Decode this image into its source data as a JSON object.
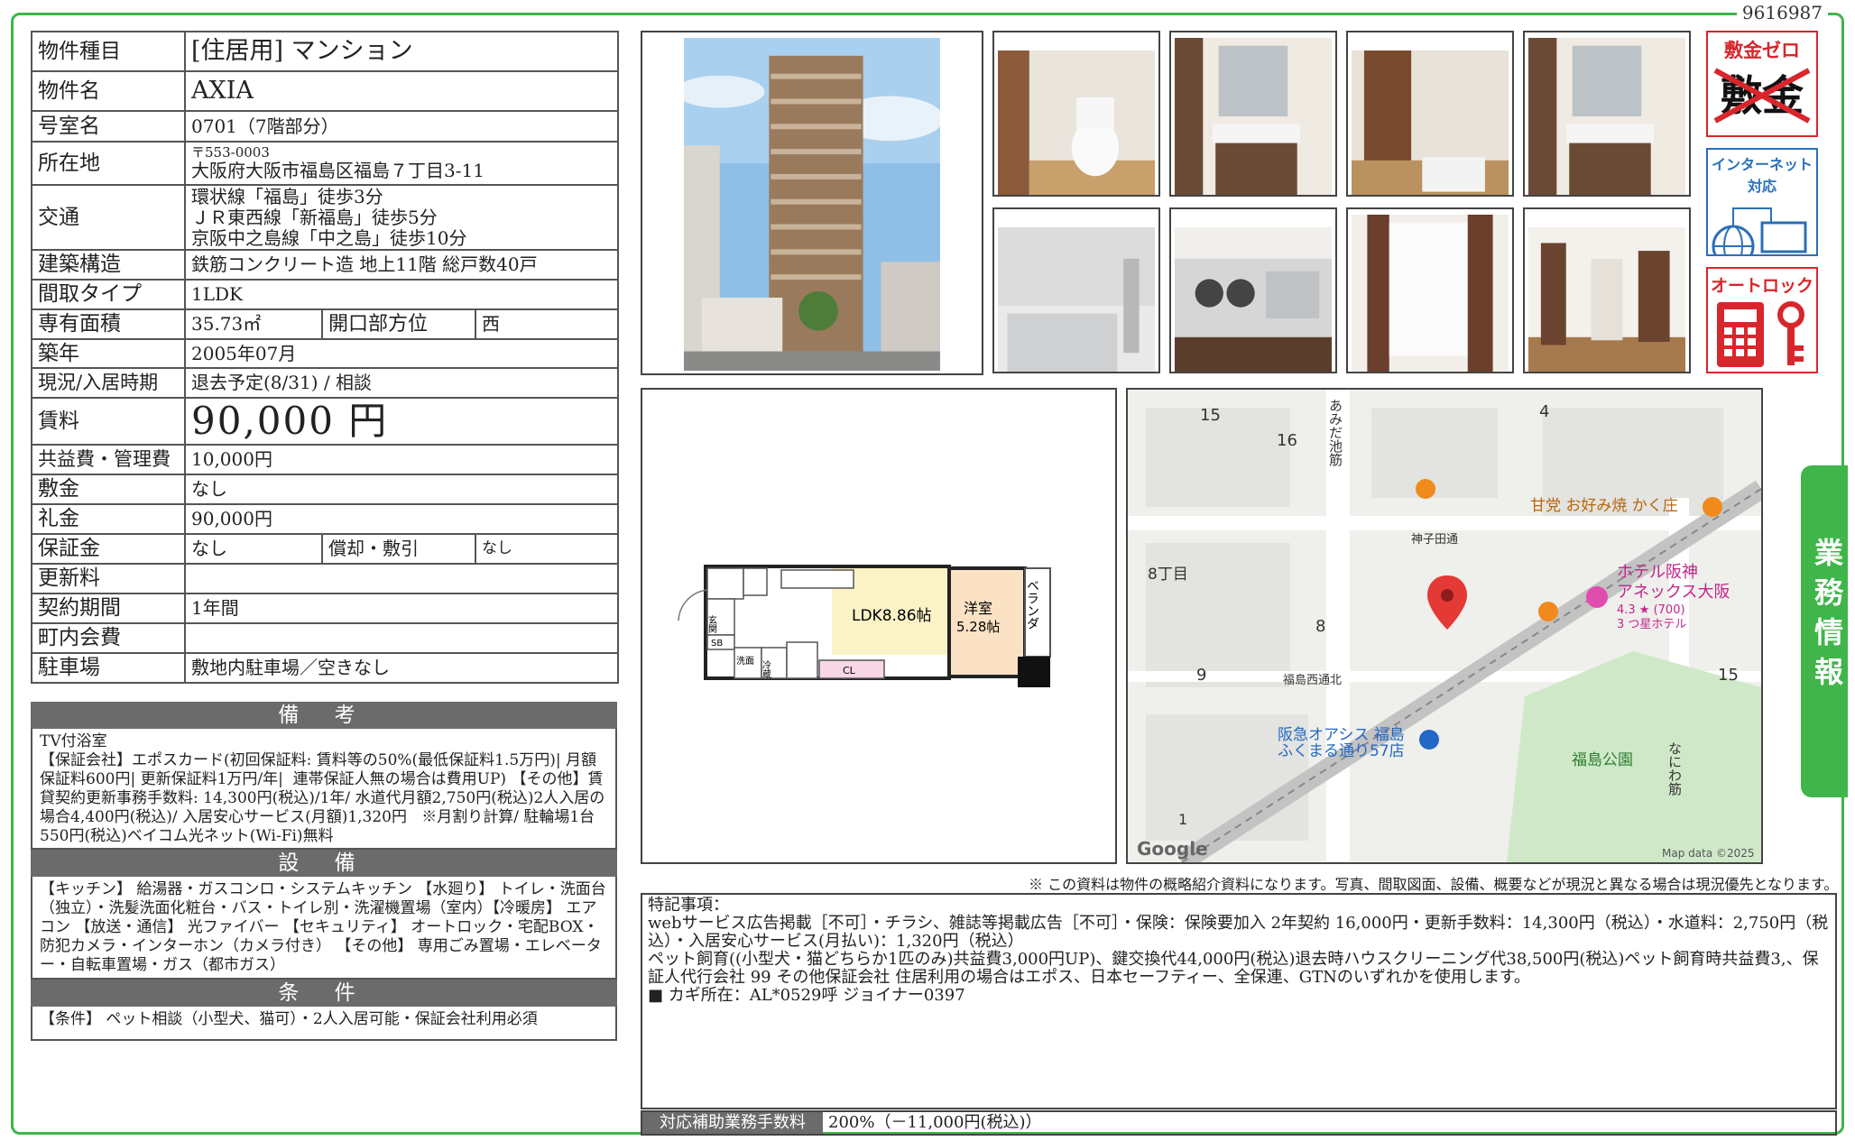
{
  "doc_id": "9616987",
  "property": {
    "type_label": "物件種目",
    "type_value": "[住居用] マンション",
    "name_label": "物件名",
    "name_value": "AXIA",
    "room_label": "号室名",
    "room_value": "0701（7階部分）",
    "address_label": "所在地",
    "postal": "〒553-0003",
    "address_value": "大阪府大阪市福島区福島７丁目3-11",
    "transport_label": "交通",
    "transport": [
      "環状線「福島」徒歩3分",
      "ＪＲ東西線「新福島」徒歩5分",
      "京阪中之島線「中之島」徒歩10分"
    ],
    "structure_label": "建築構造",
    "structure_value": "鉄筋コンクリート造 地上11階 総戸数40戸",
    "layout_label": "間取タイプ",
    "layout_value": "1LDK",
    "area_label": "専有面積",
    "area_value": "35.73㎡",
    "orientation_label": "開口部方位",
    "orientation_value": "西",
    "built_label": "築年",
    "built_value": "2005年07月",
    "status_label": "現況/入居時期",
    "status_value": "退去予定(8/31) / 相談",
    "rent_label": "賃料",
    "rent_value": "90,000 円",
    "fee_label": "共益費・管理費",
    "fee_value": "10,000円",
    "deposit_label": "敷金",
    "deposit_value": "なし",
    "key_money_label": "礼金",
    "key_money_value": "90,000円",
    "guarantee_label": "保証金",
    "guarantee_value": "なし",
    "amortize_label": "償却・敷引",
    "amortize_value": "なし",
    "renewal_label": "更新料",
    "renewal_value": "",
    "contract_label": "契約期間",
    "contract_value": "1年間",
    "town_fee_label": "町内会費",
    "town_fee_value": "",
    "parking_label": "駐車場",
    "parking_value": "敷地内駐車場／空きなし"
  },
  "remarks": {
    "heading": "備 考",
    "text": "TV付浴室\n【保証会社】エポスカード(初回保証料: 賃料等の50%(最低保証料1.5万円)| 月額保証料600円| 更新保証料1万円/年|  連帯保証人無の場合は費用UP) 【その他】賃貸契約更新事務手数料: 14,300円(税込)/1年/ 水道代月額2,750円(税込)2人入居の場合4,400円(税込)/ 入居安心サービス(月額)1,320円   ※月割り計算/ 駐輪場1台550円(税込)ベイコム光ネット(Wi-Fi)無料"
  },
  "equipment": {
    "heading": "設 備",
    "text": "【キッチン】 給湯器・ガスコンロ・システムキッチン 【水廻り】 トイレ・洗面台（独立）・洗髪洗面化粧台・バス・トイレ別・洗濯機置場（室内）【冷暖房】 エアコン 【放送・通信】 光ファイバー 【セキュリティ】 オートロック・宅配BOX・防犯カメラ・インターホン（カメラ付き） 【その他】 専用ごみ置場・エレベーター・自転車置場・ガス（都市ガス）"
  },
  "conditions": {
    "heading": "条 件",
    "text": "【条件】 ペット相談（小型犬、猫可）・2人入居可能・保証会社利用必須"
  },
  "badges": {
    "zero_title": "敷金ゼロ",
    "zero_crossed": "敷金",
    "internet_title": "インターネット対応",
    "autolock_title": "オートロック"
  },
  "floorplan": {
    "ldk": "LDK8.86帖",
    "western_1": "洋室",
    "western_2": "5.28帖",
    "balcony": "ベランダ",
    "cl": "CL",
    "sb": "SB",
    "wash": "洗面",
    "entrance": "玄関",
    "wm": "冷蔵"
  },
  "map": {
    "labels": [
      "15",
      "16",
      "4",
      "8丁目",
      "8",
      "9",
      "15",
      "1"
    ],
    "street_1": "あみだ池筋",
    "street_2": "なにわ筋",
    "intersection_1": "神子田通",
    "intersection_2": "福島西通北",
    "poi_1": "甘党 お好み焼 かく庄",
    "hotel_1": "ホテル阪神",
    "hotel_2": "アネックス大阪",
    "hotel_rating": "4.3 ★ (700)",
    "hotel_class": "3 つ星ホテル",
    "store_1": "阪急オアシス 福島",
    "store_2": "ふくまる通り57店",
    "park": "福島公園",
    "line": "JR環状線",
    "google": "Google",
    "map_data": "Map data ©2025"
  },
  "disclaimer": "※ この資料は物件の概略紹介資料になります。写真、間取図面、設備、概要などが現況と異なる場合は現況優先となります。",
  "special": {
    "title": "特記事項：",
    "line1": "webサービス広告掲載［不可］・チラシ、雑誌等掲載広告［不可］・保険：保険要加入 2年契約 16,000円・更新手数料：14,300円（税込）・水道料：2,750円（税込）・入居安心サービス(月払い)：1,320円（税込）",
    "line2": "ペット飼育((小型犬・猫どちらか1匹のみ)共益費3,000円UP)、鍵交換代44,000円(税込)退去時ハウスクリーニング代38,500円(税込)ペット飼育時共益費3,、保証人代行会社 99 その他保証会社  住居利用の場合はエポス、日本セーフティー、全保連、GTNのいずれかを使用します。",
    "line3": "■ カギ所在：AL*0529呼  ジョイナー0397"
  },
  "support_fee": {
    "label": "対応補助業務手数料",
    "value": "200%（－11,000円(税込)）"
  },
  "side_tab": "業務情報",
  "colors": {
    "green": "#3fb54a",
    "red": "#d8262c",
    "header_gray": "#6b6b6b"
  },
  "icons": [
    "internet-globe-laptop-icon",
    "autolock-keypad-key-icon",
    "map-pin-icon",
    "restaurant-icon",
    "hotel-icon",
    "shopping-cart-icon"
  ]
}
